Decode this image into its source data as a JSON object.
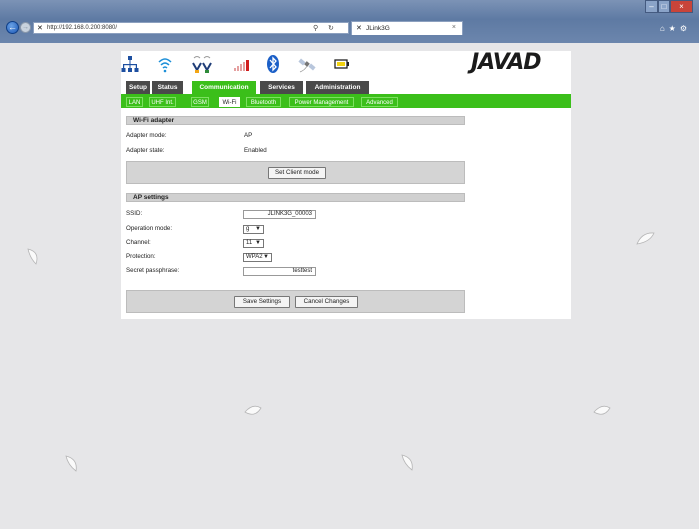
{
  "browser": {
    "url": "http://192.168.0.200:8080/",
    "url_suffix": "",
    "tab_title": "JLink3G",
    "tab_icon": "javad-icon",
    "colors": {
      "chrome": "#6c86ad",
      "close": "#c8443a"
    }
  },
  "logo": {
    "text": "JAVAD"
  },
  "status_icons": [
    "ethernet-icon",
    "wifi-icon",
    "antenna-icon",
    "signal-icon",
    "bluetooth-icon",
    "satellite-icon",
    "battery-icon"
  ],
  "main_tabs": [
    "Setup",
    "Status",
    "Communication",
    "Services",
    "Administration"
  ],
  "main_tab_active": "Communication",
  "sub_tabs": [
    "LAN",
    "UHF Int.",
    "GSM",
    "Wi-Fi",
    "Bluetooth",
    "Power Management",
    "Advanced"
  ],
  "sub_tab_active": "Wi-Fi",
  "wifi_adapter": {
    "heading": "Wi-Fi adapter",
    "mode_label": "Adapter mode:",
    "mode_value": "AP",
    "state_label": "Adapter state:",
    "state_value": "Enabled",
    "client_button": "Set Client mode"
  },
  "ap_settings": {
    "heading": "AP settings",
    "ssid_label": "SSID:",
    "ssid_value": "JLINK3G_00003",
    "op_mode_label": "Operation mode:",
    "op_mode_value": "g",
    "channel_label": "Channel:",
    "channel_value": "11",
    "protection_label": "Protection:",
    "protection_value": "WPA2",
    "passphrase_label": "Secret passphrase:",
    "passphrase_value": "testtest",
    "save_button": "Save Settings",
    "cancel_button": "Cancel Changes"
  },
  "colors": {
    "accent_green": "#3bbf1a",
    "tab_dark": "#4a4a4a",
    "section_gray": "#d0d0d0"
  }
}
